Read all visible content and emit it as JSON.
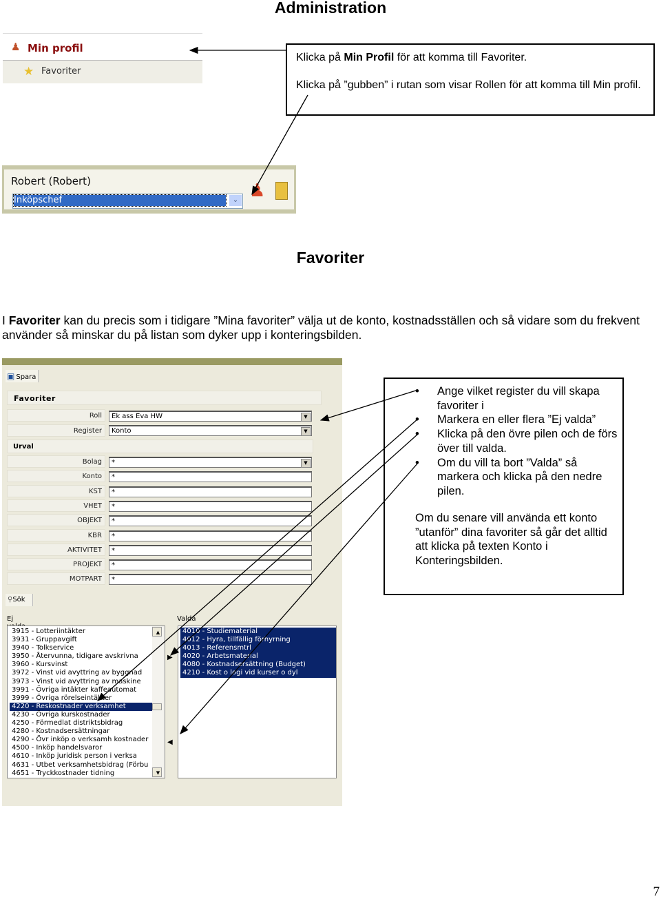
{
  "title": "Administration",
  "menu": {
    "min_profil": "Min profil",
    "favoriter": "Favoriter"
  },
  "callout1": {
    "p1_pre": "Klicka på ",
    "p1_bold": "Min Profil",
    "p1_post": " för att komma till Favoriter.",
    "p2": "Klicka på ”gubben” i rutan som visar Rollen för att komma till Min profil."
  },
  "userbox": {
    "name": "Robert (Robert)",
    "role": "Inköpschef"
  },
  "section_title": "Favoriter",
  "intro": {
    "pre": "I ",
    "bold": "Favoriter",
    "post": " kan du precis som i tidigare ”Mina favoriter” välja ut de konto, kostnadsställen och så vidare som du frekvent använder så minskar du på listan som dyker upp i konteringsbilden."
  },
  "form": {
    "save": "Spara",
    "heading": "Favoriter",
    "urval": "Urval",
    "search": "Sök",
    "roll": {
      "label": "Roll",
      "value": "Ek ass Eva HW"
    },
    "register": {
      "label": "Register",
      "value": "Konto"
    },
    "fields": [
      {
        "label": "Bolag",
        "value": "*"
      },
      {
        "label": "Konto",
        "value": "*"
      },
      {
        "label": "KST",
        "value": "*"
      },
      {
        "label": "VHET",
        "value": "*"
      },
      {
        "label": "OBJEKT",
        "value": "*"
      },
      {
        "label": "KBR",
        "value": "*"
      },
      {
        "label": "AKTIVITET",
        "value": "*"
      },
      {
        "label": "PROJEKT",
        "value": "*"
      },
      {
        "label": "MOTPART",
        "value": "*"
      }
    ],
    "ej_valda_label": "Ej valda",
    "valda_label": "Valda",
    "ej_valda": [
      "3915 - Lotteriintäkter",
      "3931 - Gruppavgift",
      "3940 - Tolkservice",
      "3950 - Återvunna, tidigare avskrivna",
      "3960 - Kursvinst",
      "3972 - Vinst vid avyttring av byggnad",
      "3973 - Vinst vid avyttring av maskine",
      "3991 - Övriga intäkter kaffeautomat",
      "3999 - Övriga rörelseintäkter",
      "4220 - Reskostnader verksamhet",
      "4230 - Övriga kurskostnader",
      "4250 - Förmedlat distriktsbidrag",
      "4280 - Kostnadsersättningar",
      "4290 - Övr inköp o verksamh kostnader",
      "4500 - Inköp handelsvaror",
      "4610 - Inköp juridisk person i verksa",
      "4631 - Utbet verksamhetsbidrag (Förbu",
      "4651 - Tryckkostnader tidning"
    ],
    "ej_valda_selected": "4220 - Reskostnader verksamhet",
    "valda": [
      "4010 - Studiematerial",
      "4012 - Hyra, tillfällig förhyrning",
      "4013 - Referensmtrl",
      "4020 - Arbetsmaterial",
      "4080 - Kostnadsersättning (Budget)",
      "4210 - Kost o logi vid kurser o dyl"
    ]
  },
  "callout2": {
    "bullets": [
      "Ange vilket register du vill skapa favoriter i",
      "Markera en eller flera ”Ej valda”",
      "Klicka på den övre pilen och de förs över till valda.",
      "Om du vill ta bort ”Valda” så markera och klicka på den nedre pilen."
    ],
    "para": "Om du senare vill använda ett konto ”utanför” dina favoriter så går det alltid att klicka på texten Konto i Konteringsbilden."
  },
  "page_number": "7"
}
